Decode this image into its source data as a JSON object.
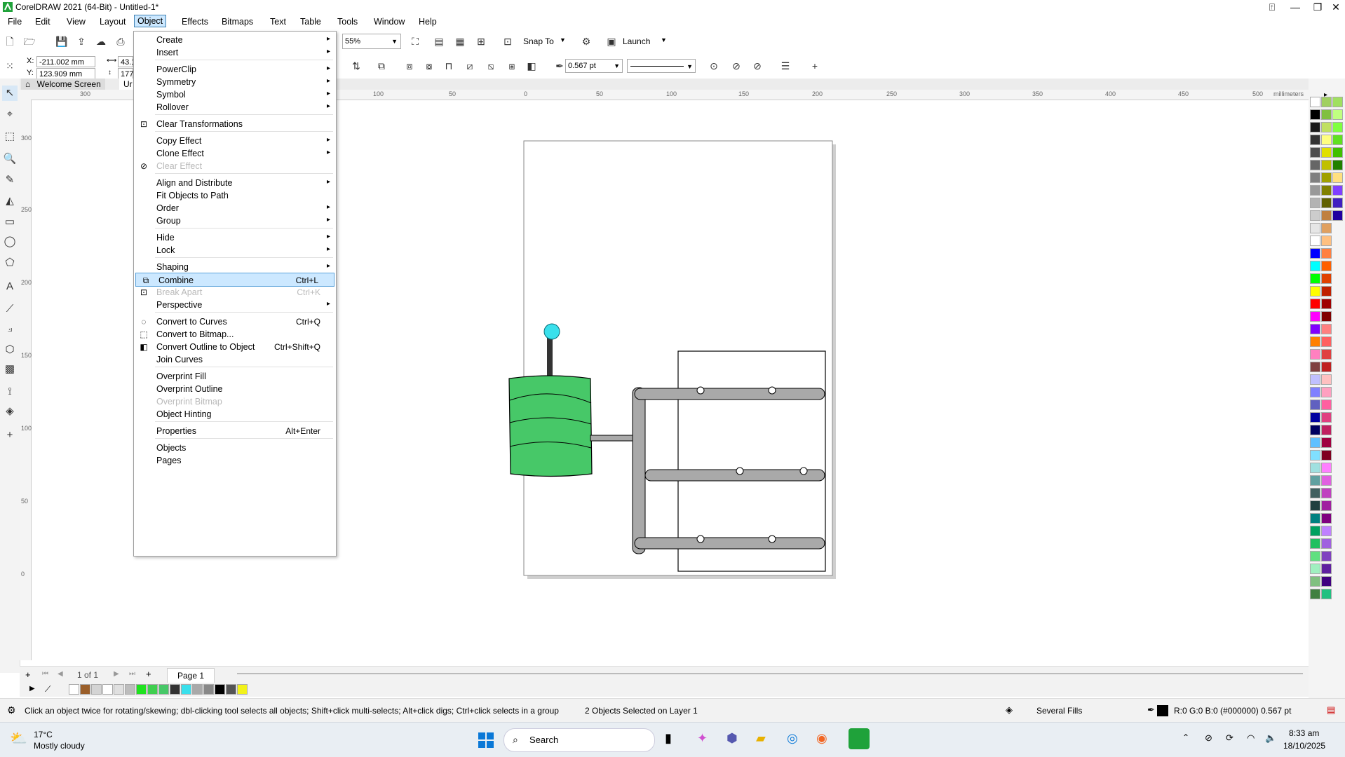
{
  "window": {
    "title": "CorelDRAW 2021 (64-Bit) - Untitled-1*"
  },
  "menubar": [
    "File",
    "Edit",
    "View",
    "Layout",
    "Object",
    "Effects",
    "Bitmaps",
    "Text",
    "Table",
    "Tools",
    "Window",
    "Help"
  ],
  "toolbar": {
    "zoom": "55%",
    "snap_to": "Snap To",
    "launch": "Launch",
    "x": "-211.002 mm",
    "y": "123.909 mm",
    "w_partial": "43.1",
    "h_partial": "177",
    "outline_width": "0.567 pt"
  },
  "tabs": {
    "welcome": "Welcome Screen",
    "doc_partial": "Ur"
  },
  "ruler": {
    "unit": "millimeters",
    "h_labels": [
      "300",
      "100",
      "50",
      "0",
      "50",
      "100",
      "150",
      "200",
      "250",
      "300",
      "350",
      "400",
      "450",
      "500"
    ],
    "v_labels": [
      "300",
      "250",
      "200",
      "150",
      "100",
      "50",
      "0"
    ]
  },
  "object_menu": {
    "items": [
      {
        "label": "Create",
        "arrow": true
      },
      {
        "label": "Insert",
        "arrow": true
      },
      {
        "label": "PowerClip",
        "arrow": true
      },
      {
        "label": "Symmetry",
        "arrow": true
      },
      {
        "label": "Symbol",
        "arrow": true
      },
      {
        "label": "Rollover",
        "arrow": true
      },
      {
        "label": "Clear Transformations"
      },
      {
        "label": "Copy Effect",
        "arrow": true
      },
      {
        "label": "Clone Effect",
        "arrow": true
      },
      {
        "label": "Clear Effect",
        "disabled": true
      },
      {
        "label": "Align and Distribute",
        "arrow": true
      },
      {
        "label": "Fit Objects to Path"
      },
      {
        "label": "Order",
        "arrow": true
      },
      {
        "label": "Group",
        "arrow": true
      },
      {
        "label": "Hide",
        "arrow": true
      },
      {
        "label": "Lock",
        "arrow": true
      },
      {
        "label": "Shaping",
        "arrow": true
      },
      {
        "label": "Combine",
        "shortcut": "Ctrl+L",
        "highlight": true
      },
      {
        "label": "Break Apart",
        "shortcut": "Ctrl+K",
        "disabled": true
      },
      {
        "label": "Perspective",
        "arrow": true
      },
      {
        "label": "Convert to Curves",
        "shortcut": "Ctrl+Q"
      },
      {
        "label": "Convert to Bitmap..."
      },
      {
        "label": "Convert Outline to Object",
        "shortcut": "Ctrl+Shift+Q"
      },
      {
        "label": "Join Curves"
      },
      {
        "label": "Overprint Fill"
      },
      {
        "label": "Overprint Outline"
      },
      {
        "label": "Overprint Bitmap",
        "disabled": true
      },
      {
        "label": "Object Hinting"
      },
      {
        "label": "Properties",
        "shortcut": "Alt+Enter"
      },
      {
        "label": "Objects"
      },
      {
        "label": "Pages"
      }
    ]
  },
  "pagebar": {
    "page_count": "1 of 1",
    "page_tab": "Page 1"
  },
  "status": {
    "hint": "Click an object twice for rotating/skewing; dbl-clicking tool selects all objects; Shift+click multi-selects; Alt+click digs; Ctrl+click selects in a group",
    "selection": "2 Objects Selected on Layer 1",
    "fill": "Several Fills",
    "outline": "R:0 G:0 B:0 (#000000)  0.567 pt"
  },
  "taskbar": {
    "temp": "17°C",
    "weather": "Mostly cloudy",
    "search": "Search",
    "time": "8:33 am",
    "date": "18/10/2025"
  },
  "colors": {
    "accent": "#0078d4",
    "tank_green": "#47c868",
    "cyan_ball": "#3ae0ec",
    "pipe_gray": "#a9a9a9"
  }
}
